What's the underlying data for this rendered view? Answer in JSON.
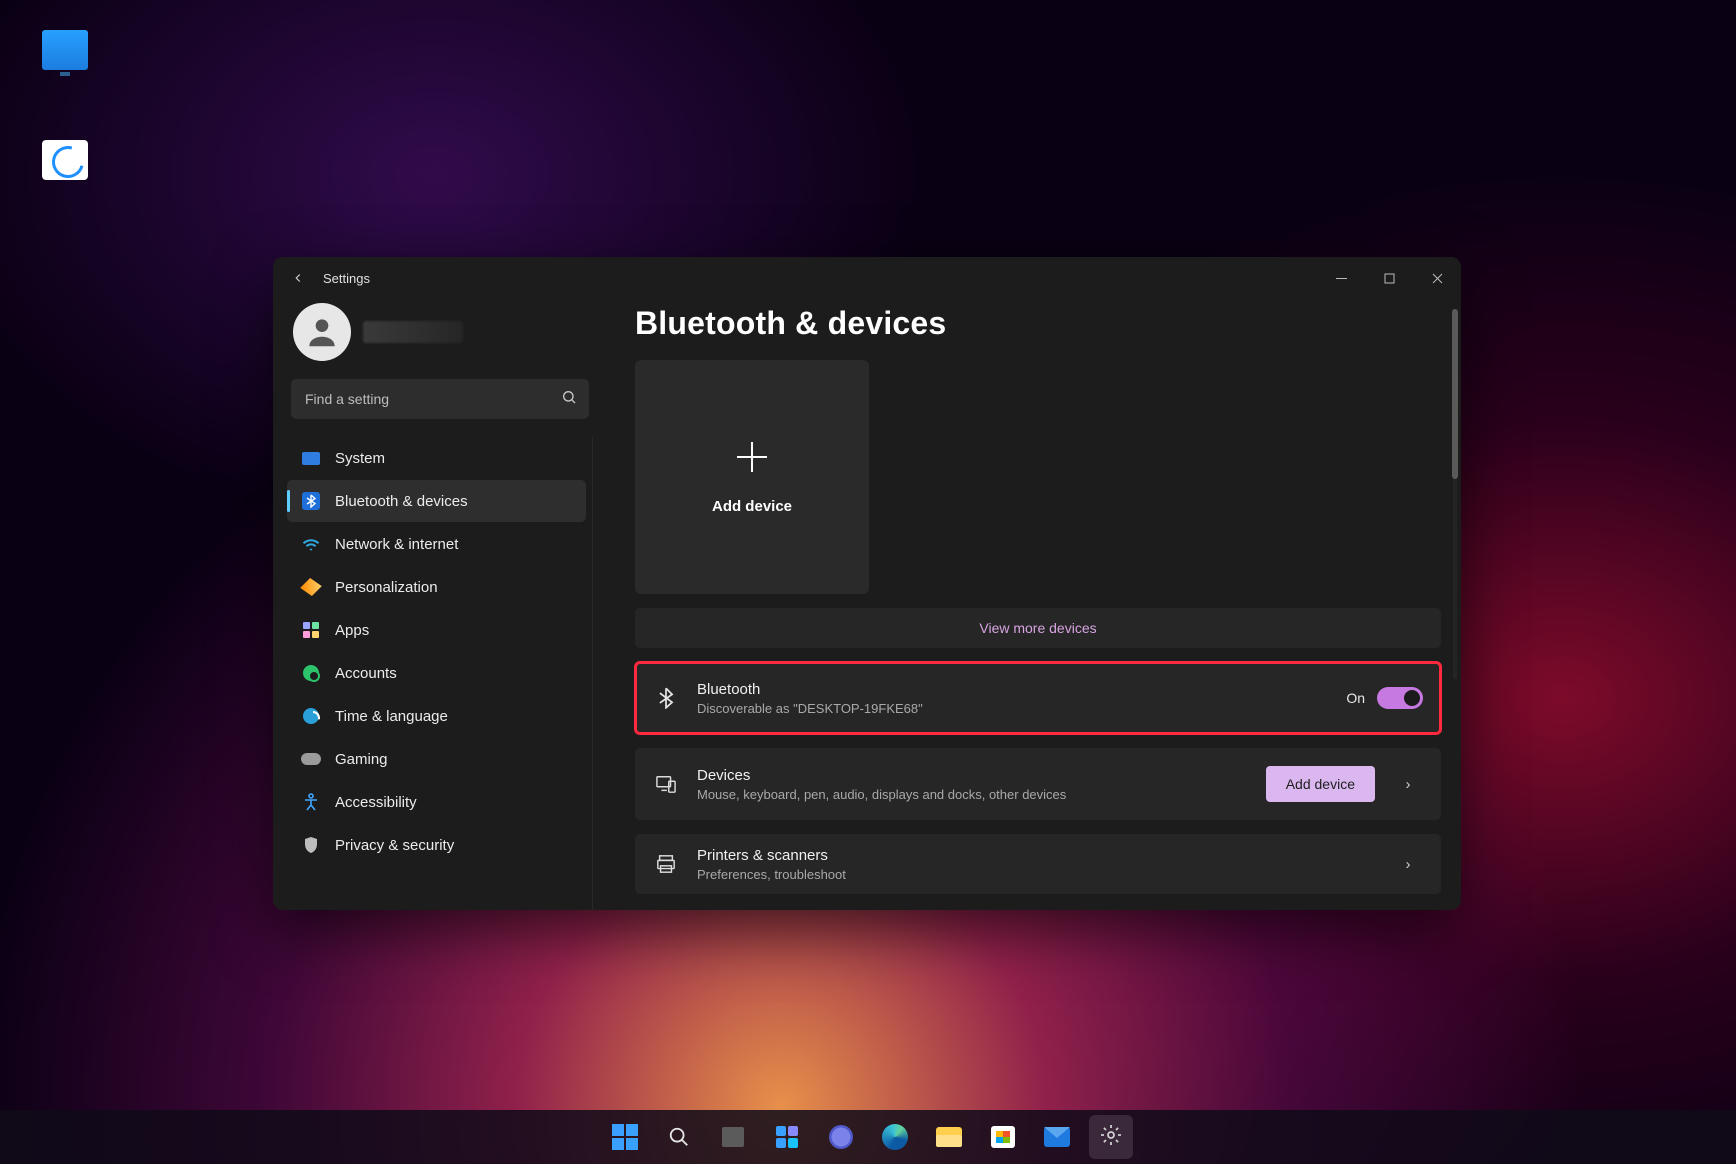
{
  "window": {
    "title": "Settings",
    "page_title": "Bluetooth & devices"
  },
  "search": {
    "placeholder": "Find a setting"
  },
  "nav": {
    "items": [
      {
        "label": "System"
      },
      {
        "label": "Bluetooth & devices"
      },
      {
        "label": "Network & internet"
      },
      {
        "label": "Personalization"
      },
      {
        "label": "Apps"
      },
      {
        "label": "Accounts"
      },
      {
        "label": "Time & language"
      },
      {
        "label": "Gaming"
      },
      {
        "label": "Accessibility"
      },
      {
        "label": "Privacy & security"
      }
    ],
    "active_index": 1
  },
  "add_tile": {
    "label": "Add device"
  },
  "view_more": "View more devices",
  "bluetooth": {
    "title": "Bluetooth",
    "subtitle": "Discoverable as \"DESKTOP-19FKE68\"",
    "state": "On"
  },
  "devices": {
    "title": "Devices",
    "subtitle": "Mouse, keyboard, pen, audio, displays and docks, other devices",
    "button": "Add device"
  },
  "printers": {
    "title": "Printers & scanners",
    "subtitle": "Preferences, troubleshoot"
  }
}
